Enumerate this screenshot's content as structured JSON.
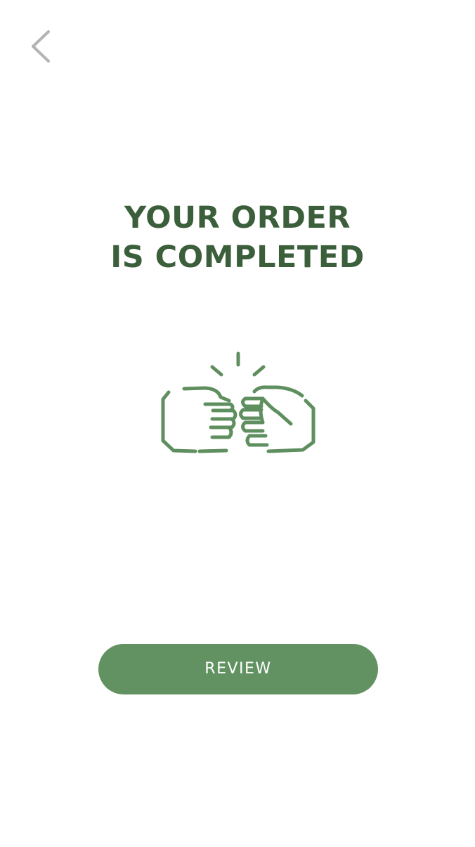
{
  "header": {
    "back_icon": "chevron-left-icon"
  },
  "main": {
    "title_line1": "YOUR ORDER",
    "title_line2": "IS COMPLETED",
    "illustration_icon": "fist-bump-icon"
  },
  "actions": {
    "review_label": "REVIEW"
  },
  "colors": {
    "title": "#3b5e3b",
    "accent": "#629262",
    "icon_stroke": "#5f8f5f",
    "back_icon": "#b3b3b3"
  }
}
